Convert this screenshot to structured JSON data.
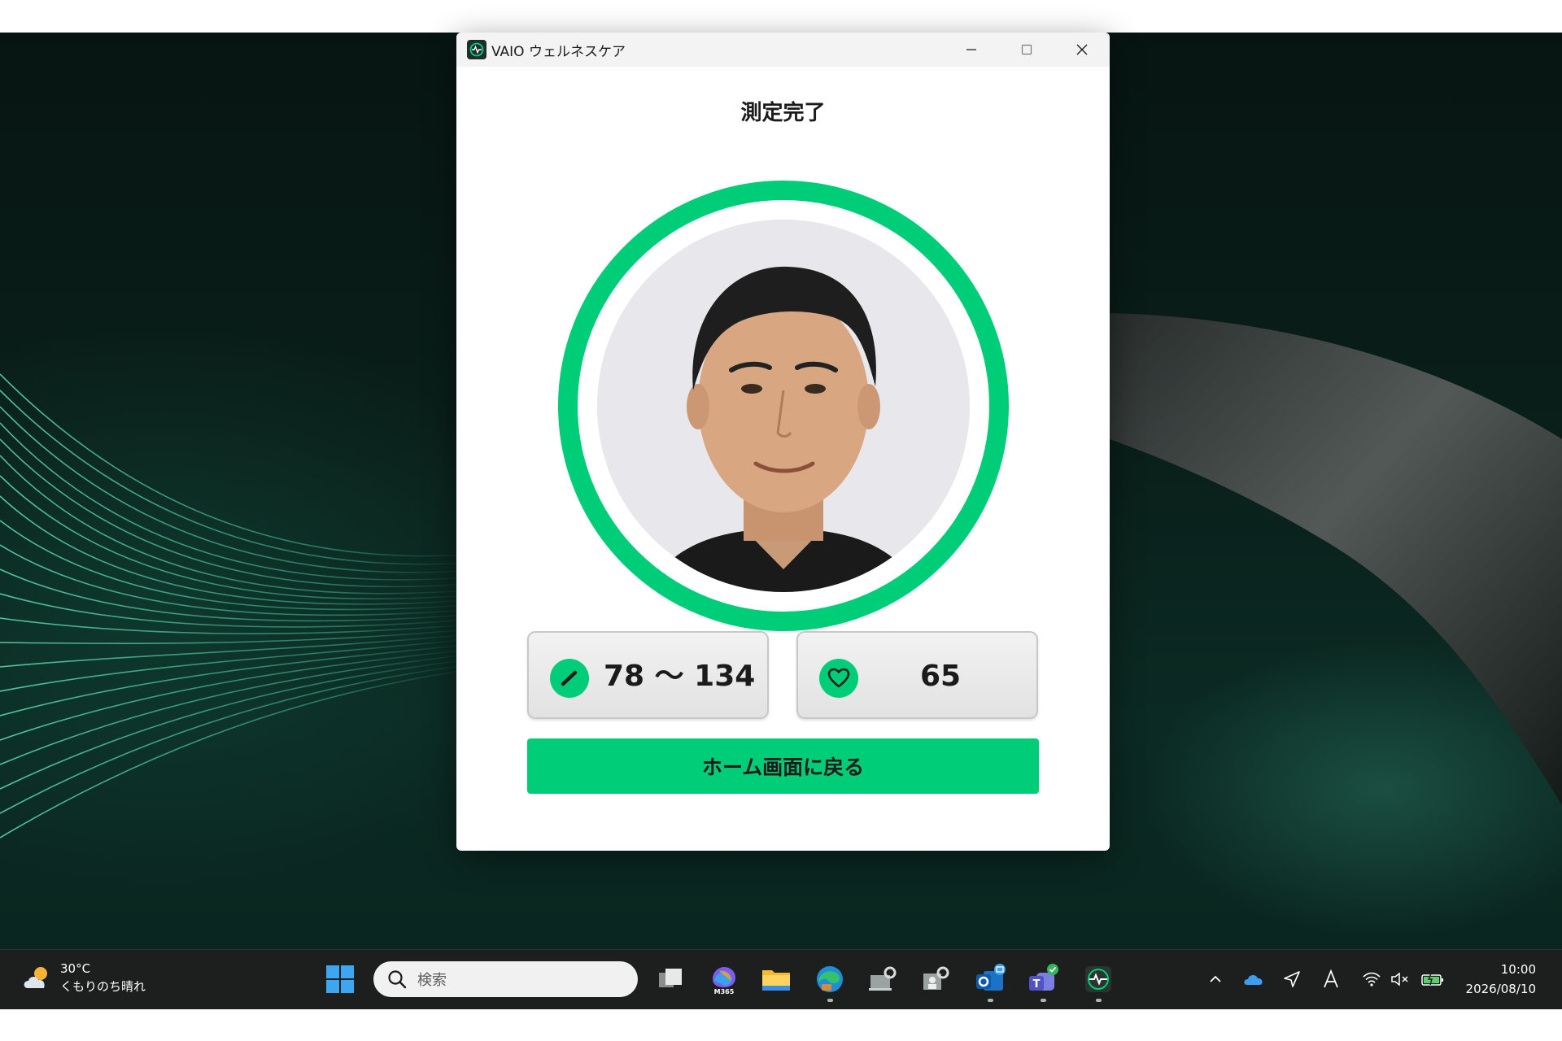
{
  "window": {
    "title": "VAIO ウェルネスケア",
    "heading": "測定完了"
  },
  "metrics": {
    "blood_pressure": {
      "value": "78 〜 134",
      "icon": "gauge-icon"
    },
    "heart_rate": {
      "value": "65",
      "icon": "heart-icon"
    }
  },
  "actions": {
    "home_button_label": "ホーム画面に戻る"
  },
  "taskbar": {
    "weather_temp": "30°C",
    "weather_desc": "くもりのち晴れ",
    "search_placeholder": "検索",
    "m365_label": "M365",
    "clock_time": "10:00",
    "clock_date": "2026/08/10"
  },
  "colors": {
    "accent": "#00cd78",
    "taskbar_bg": "#1c1f1e"
  }
}
